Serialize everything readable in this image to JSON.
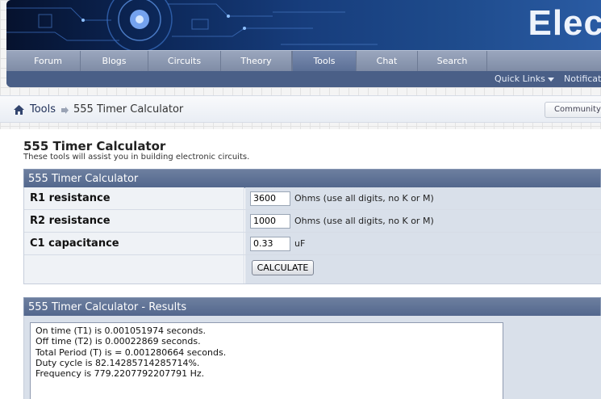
{
  "header": {
    "site_title": "Elec"
  },
  "nav": {
    "tabs": [
      {
        "label": "Forum"
      },
      {
        "label": "Blogs"
      },
      {
        "label": "Circuits"
      },
      {
        "label": "Theory"
      },
      {
        "label": "Tools"
      },
      {
        "label": "Chat"
      },
      {
        "label": "Search"
      }
    ],
    "active_tab": "Tools",
    "quick_links": "Quick Links",
    "notifications": "Notificati"
  },
  "breadcrumb": {
    "parent": "Tools",
    "current": "555 Timer Calculator",
    "community_button": "Community"
  },
  "page": {
    "title": "555 Timer Calculator",
    "subtitle": "These tools will assist you in building electronic circuits."
  },
  "form": {
    "header": "555 Timer Calculator",
    "rows": [
      {
        "label": "R1 resistance",
        "value": "3600",
        "unit": "Ohms (use all digits, no K or M)"
      },
      {
        "label": "R2 resistance",
        "value": "1000",
        "unit": "Ohms (use all digits, no K or M)"
      },
      {
        "label": "C1 capacitance",
        "value": "0.33",
        "unit": "uF"
      }
    ],
    "button": "CALCULATE"
  },
  "results": {
    "header": "555 Timer Calculator - Results",
    "lines": [
      "On time (T1) is 0.001051974 seconds.",
      "Off time (T2) is 0.00022869 seconds.",
      "Total Period (T) is = 0.001280664 seconds.",
      "Duty cycle is 82.14285714285714%.",
      "Frequency is 779.2207792207791 Hz."
    ]
  },
  "colors": {
    "navbar": "#8a96ae",
    "panel_header": "#5f7296",
    "value_cell": "#d9e0ea",
    "label_cell": "#eff2f6"
  }
}
